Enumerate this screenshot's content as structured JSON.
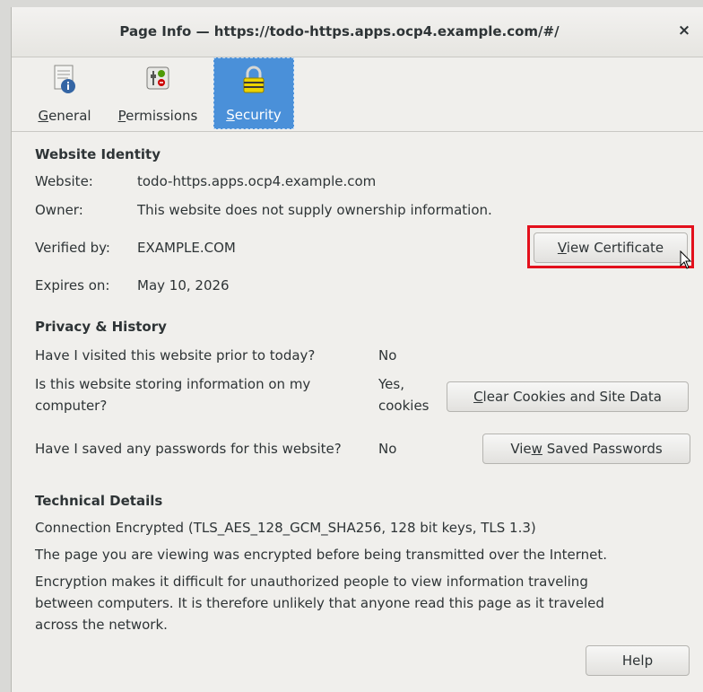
{
  "window": {
    "title": "Page Info — https://todo-https.apps.ocp4.example.com/#/",
    "close_glyph": "×"
  },
  "tabs": [
    {
      "label_first": "G",
      "label_rest": "eneral",
      "icon": "info-document-icon",
      "active": false
    },
    {
      "label_first": "P",
      "label_rest": "ermissions",
      "icon": "permissions-toggle-icon",
      "active": false
    },
    {
      "label_first": "S",
      "label_rest": "ecurity",
      "icon": "padlock-icon",
      "active": true
    }
  ],
  "identity": {
    "heading": "Website Identity",
    "website_label": "Website:",
    "website_value": "todo-https.apps.ocp4.example.com",
    "owner_label": "Owner:",
    "owner_value": "This website does not supply ownership information.",
    "verified_label": "Verified by:",
    "verified_value": "EXAMPLE.COM",
    "expires_label": "Expires on:",
    "expires_value": "May 10, 2026",
    "view_cert_u": "V",
    "view_cert_rest": "iew Certificate"
  },
  "privacy": {
    "heading": "Privacy & History",
    "q1": "Have I visited this website prior to today?",
    "a1": "No",
    "q2_line1": "Is this website storing information on my",
    "q2_line2": "computer?",
    "a2_line1": "Yes,",
    "a2_line2": "cookies",
    "clear_u": "C",
    "clear_rest": "lear Cookies and Site Data",
    "q3": "Have I saved any passwords for this website?",
    "a3": "No",
    "viewpw_pre": "Vie",
    "viewpw_u": "w",
    "viewpw_rest": " Saved Passwords"
  },
  "technical": {
    "heading": "Technical Details",
    "line1": "Connection Encrypted (TLS_AES_128_GCM_SHA256, 128 bit keys, TLS 1.3)",
    "line2": "The page you are viewing was encrypted before being transmitted over the Internet.",
    "line3a": "Encryption makes it difficult for unauthorized people to view information traveling",
    "line3b": "between computers. It is therefore unlikely that anyone read this page as it traveled",
    "line3c": "across the network."
  },
  "help_label": "Help",
  "colors": {
    "accent": "#4a90d9",
    "highlight": "#e3101c"
  }
}
